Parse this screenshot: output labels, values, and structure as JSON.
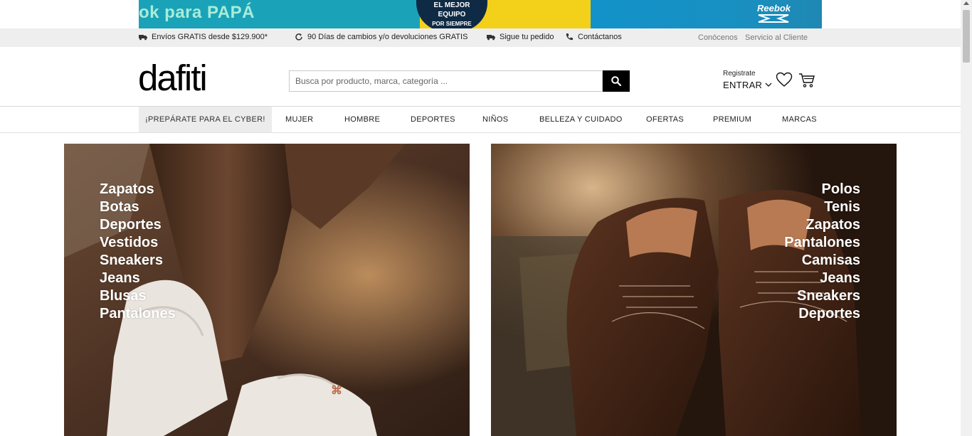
{
  "promo_banner": {
    "left_text": "ok para ",
    "left_text_highlight": "PAPÁ",
    "badge_lines": [
      "EL MEJOR",
      "EQUIPO",
      "POR SIEMPRE"
    ],
    "brand": "Reebok",
    "colors": {
      "teal": "#1aa3b8",
      "yellow": "#f3d11a",
      "blue": "#1292c9"
    }
  },
  "info_bar": {
    "shipping": "Envíos GRATIS desde $129.900*",
    "returns": "90 Días de cambios y/o devoluciones GRATIS",
    "track": "Sigue tu pedido",
    "contact": "Contáctanos",
    "about": "Conócenos",
    "service": "Servicio al Cliente"
  },
  "header": {
    "logo": "dafiti",
    "search_placeholder": "Busca por producto, marca, categoría ...",
    "register": "Registrate",
    "login": "ENTRAR"
  },
  "nav": {
    "items": [
      "¡PREPÁRATE PARA EL CYBER!",
      "MUJER",
      "HOMBRE",
      "DEPORTES",
      "NIÑOS",
      "BELLEZA Y CUIDADO",
      "OFERTAS",
      "PREMIUM",
      "MARCAS"
    ]
  },
  "hero_left": {
    "links": [
      "Zapatos",
      "Botas",
      "Deportes",
      "Vestidos",
      "Sneakers",
      "Jeans",
      "Blusas",
      "Pantalones"
    ]
  },
  "hero_right": {
    "links": [
      "Polos",
      "Tenis",
      "Zapatos",
      "Pantalones",
      "Camisas",
      "Jeans",
      "Sneakers",
      "Deportes"
    ]
  }
}
